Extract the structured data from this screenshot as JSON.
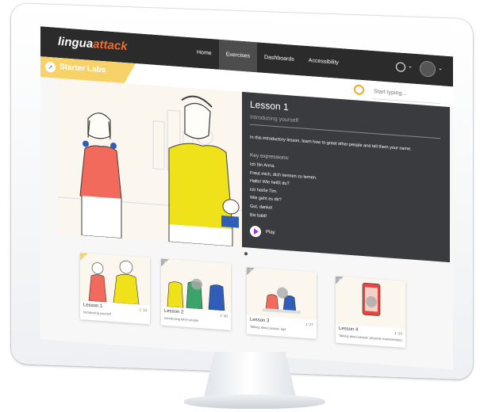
{
  "nav": {
    "logo_main": "lingua",
    "logo_accent": "attack",
    "links": [
      "Home",
      "Exercises",
      "Dashboards",
      "Accessibility"
    ],
    "active_link": "Exercises"
  },
  "subheader": {
    "labs_title": "Starter Labs",
    "search_placeholder": "Start typing..."
  },
  "lesson": {
    "title": "Lesson 1",
    "subtitle": "Introducing yourself",
    "description": "In this introductory lesson, learn how to greet other people and tell them your name.",
    "key_label": "Key expressions:",
    "expressions": [
      "Ich bin Anna.",
      "Freut mich, dich kennen zu lernen.",
      "Hallo! Wie heißt du?",
      "Ich heiße Tim.",
      "Wie geht es dir?",
      "Gut, danke!",
      "Bis bald!"
    ],
    "play_label": "Play"
  },
  "cards": [
    {
      "num": "1",
      "title": "Lesson 1",
      "subtitle": "Introducing yourself",
      "duration": "1' 13"
    },
    {
      "num": "2",
      "title": "Lesson 2",
      "subtitle": "Introducing other people",
      "duration": "1' 40"
    },
    {
      "num": "3",
      "title": "Lesson 3",
      "subtitle": "Talking about people: age",
      "duration": "1' 27"
    },
    {
      "num": "4",
      "title": "Lesson 4",
      "subtitle": "Talking about people: physical characteristics",
      "duration": "1' 22"
    }
  ],
  "colors": {
    "nav_bg": "#2b2b2b",
    "labs_accent": "#f6d269",
    "panel_bg": "#3a3b3e",
    "logo_accent": "#f06a2a",
    "search_icon": "#f0a830",
    "play_icon": "#9b3ad6"
  }
}
